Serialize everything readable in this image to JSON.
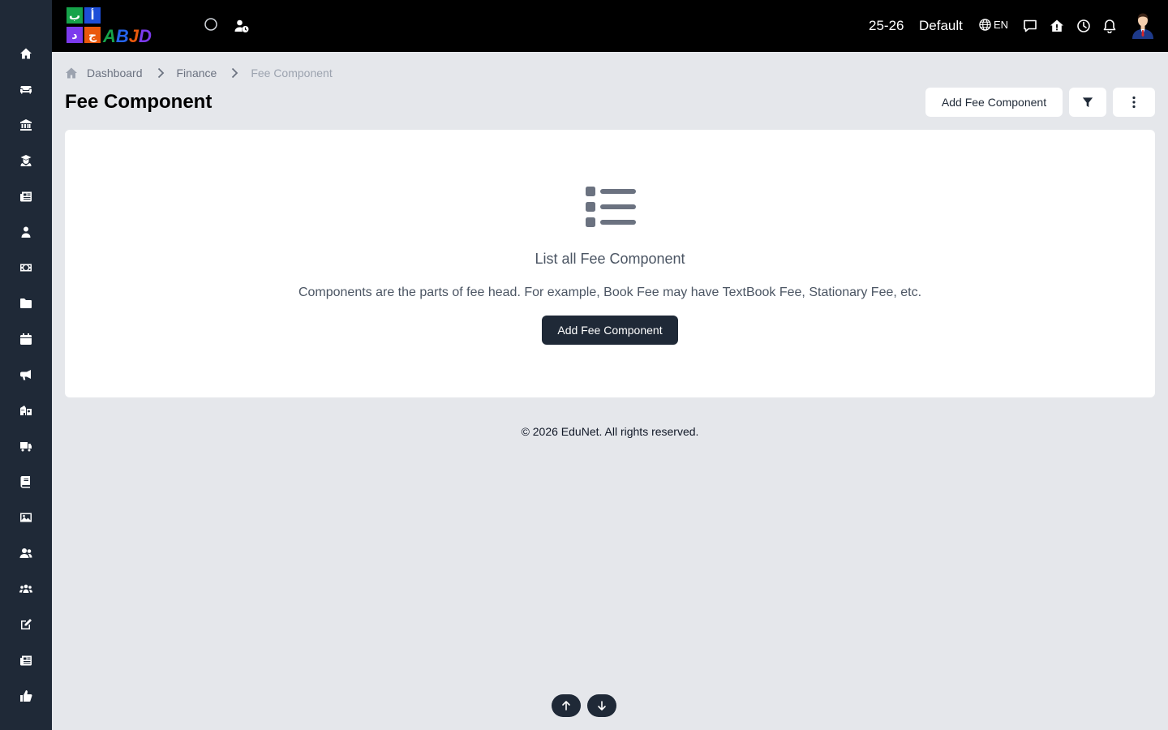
{
  "app": {
    "logo_text": "ABJD",
    "logo_letters": [
      "ب",
      "أ",
      "د",
      "ج"
    ]
  },
  "sidebar": {
    "items": [
      {
        "icon": "home-icon"
      },
      {
        "icon": "sofa-icon"
      },
      {
        "icon": "institution-icon"
      },
      {
        "icon": "graduate-icon"
      },
      {
        "icon": "newspaper-icon"
      },
      {
        "icon": "teacher-icon"
      },
      {
        "icon": "money-icon"
      },
      {
        "icon": "folder-icon"
      },
      {
        "icon": "calendar-icon"
      },
      {
        "icon": "megaphone-icon"
      },
      {
        "icon": "school-icon"
      },
      {
        "icon": "truck-icon"
      },
      {
        "icon": "book-icon"
      },
      {
        "icon": "image-icon"
      },
      {
        "icon": "users-icon"
      },
      {
        "icon": "group-icon"
      },
      {
        "icon": "edit-icon"
      },
      {
        "icon": "news-icon"
      },
      {
        "icon": "thumbs-up-icon"
      }
    ]
  },
  "topbar": {
    "session": "25-26",
    "profile": "Default",
    "language": "EN"
  },
  "breadcrumb": {
    "items": [
      "Dashboard",
      "Finance",
      "Fee Component"
    ]
  },
  "page": {
    "title": "Fee Component",
    "add_button": "Add Fee Component"
  },
  "empty_state": {
    "title": "List all Fee Component",
    "description": "Components are the parts of fee head. For example, Book Fee may have TextBook Fee, Stationary Fee, etc.",
    "button": "Add Fee Component"
  },
  "footer": {
    "text": "© 2026 EduNet. All rights reserved."
  },
  "colors": {
    "sidebar_bg": "#1f2937",
    "topbar_bg": "#000000",
    "page_bg": "#e5e7eb",
    "primary_button": "#1f2937"
  }
}
